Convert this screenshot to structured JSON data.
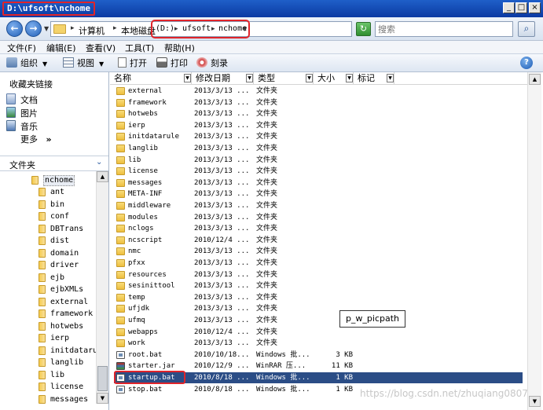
{
  "window": {
    "title": "D:\\ufsoft\\nchome"
  },
  "address": {
    "computer": "计算机",
    "local_disk": "本地磁盘",
    "drive": "(D:)",
    "ufsoft": "ufsoft",
    "nchome": "nchome"
  },
  "search": {
    "placeholder": "搜索"
  },
  "menu": [
    "文件(F)",
    "编辑(E)",
    "查看(V)",
    "工具(T)",
    "帮助(H)"
  ],
  "toolbar": {
    "organize": "组织",
    "views": "视图",
    "open": "打开",
    "print": "打印",
    "burn": "刻录"
  },
  "favorites": {
    "title": "收藏夹链接",
    "items": [
      "文档",
      "图片",
      "音乐"
    ],
    "more": "更多",
    "more_arrow": "»"
  },
  "folders": {
    "title": "文件夹",
    "root": "nchome",
    "items": [
      "ant",
      "bin",
      "conf",
      "DBTrans",
      "dist",
      "domain",
      "driver",
      "ejb",
      "ejbXMLs",
      "external",
      "framework",
      "hotwebs",
      "ierp",
      "initdatarule",
      "langlib",
      "lib",
      "license",
      "messages"
    ]
  },
  "columns": {
    "name": "名称",
    "date": "修改日期",
    "type": "类型",
    "size": "大小",
    "tags": "标记"
  },
  "files": [
    {
      "name": "external",
      "date": "2013/3/13 ...",
      "type": "文件夹",
      "size": "",
      "icon": "folder"
    },
    {
      "name": "framework",
      "date": "2013/3/13 ...",
      "type": "文件夹",
      "size": "",
      "icon": "folder"
    },
    {
      "name": "hotwebs",
      "date": "2013/3/13 ...",
      "type": "文件夹",
      "size": "",
      "icon": "folder"
    },
    {
      "name": "ierp",
      "date": "2013/3/13 ...",
      "type": "文件夹",
      "size": "",
      "icon": "folder"
    },
    {
      "name": "initdatarule",
      "date": "2013/3/13 ...",
      "type": "文件夹",
      "size": "",
      "icon": "folder"
    },
    {
      "name": "langlib",
      "date": "2013/3/13 ...",
      "type": "文件夹",
      "size": "",
      "icon": "folder"
    },
    {
      "name": "lib",
      "date": "2013/3/13 ...",
      "type": "文件夹",
      "size": "",
      "icon": "folder"
    },
    {
      "name": "license",
      "date": "2013/3/13 ...",
      "type": "文件夹",
      "size": "",
      "icon": "folder"
    },
    {
      "name": "messages",
      "date": "2013/3/13 ...",
      "type": "文件夹",
      "size": "",
      "icon": "folder"
    },
    {
      "name": "META-INF",
      "date": "2013/3/13 ...",
      "type": "文件夹",
      "size": "",
      "icon": "folder"
    },
    {
      "name": "middleware",
      "date": "2013/3/13 ...",
      "type": "文件夹",
      "size": "",
      "icon": "folder"
    },
    {
      "name": "modules",
      "date": "2013/3/13 ...",
      "type": "文件夹",
      "size": "",
      "icon": "folder"
    },
    {
      "name": "nclogs",
      "date": "2013/3/13 ...",
      "type": "文件夹",
      "size": "",
      "icon": "folder"
    },
    {
      "name": "ncscript",
      "date": "2010/12/4 ...",
      "type": "文件夹",
      "size": "",
      "icon": "folder"
    },
    {
      "name": "nmc",
      "date": "2013/3/13 ...",
      "type": "文件夹",
      "size": "",
      "icon": "folder"
    },
    {
      "name": "pfxx",
      "date": "2013/3/13 ...",
      "type": "文件夹",
      "size": "",
      "icon": "folder"
    },
    {
      "name": "resources",
      "date": "2013/3/13 ...",
      "type": "文件夹",
      "size": "",
      "icon": "folder"
    },
    {
      "name": "sesinittool",
      "date": "2013/3/13 ...",
      "type": "文件夹",
      "size": "",
      "icon": "folder"
    },
    {
      "name": "temp",
      "date": "2013/3/13 ...",
      "type": "文件夹",
      "size": "",
      "icon": "folder"
    },
    {
      "name": "ufjdk",
      "date": "2013/3/13 ...",
      "type": "文件夹",
      "size": "",
      "icon": "folder"
    },
    {
      "name": "ufmq",
      "date": "2013/3/13 ...",
      "type": "文件夹",
      "size": "",
      "icon": "folder"
    },
    {
      "name": "webapps",
      "date": "2010/12/4 ...",
      "type": "文件夹",
      "size": "",
      "icon": "folder"
    },
    {
      "name": "work",
      "date": "2013/3/13 ...",
      "type": "文件夹",
      "size": "",
      "icon": "folder"
    },
    {
      "name": "root.bat",
      "date": "2010/10/18...",
      "type": "Windows 批...",
      "size": "3 KB",
      "icon": "bat"
    },
    {
      "name": "starter.jar",
      "date": "2010/12/9 ...",
      "type": "WinRAR 压...",
      "size": "11 KB",
      "icon": "jar"
    },
    {
      "name": "startup.bat",
      "date": "2010/8/18 ...",
      "type": "Windows 批...",
      "size": "1 KB",
      "icon": "bat",
      "selected": true
    },
    {
      "name": "stop.bat",
      "date": "2010/8/18 ...",
      "type": "Windows 批...",
      "size": "1 KB",
      "icon": "bat"
    }
  ],
  "annotation": "p_w_picpath",
  "watermark": "https://blog.csdn.net/zhuqiang0807",
  "colors": {
    "title_bar": "#0b3aa3",
    "selection": "#2b4d86",
    "highlight_box": "#e0242a"
  }
}
